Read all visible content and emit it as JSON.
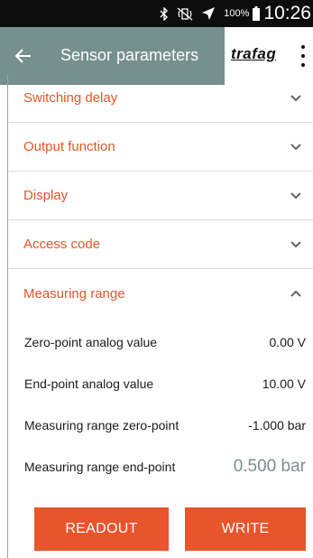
{
  "status_bar": {
    "battery_percent": "100%",
    "time": "10:26",
    "icons": [
      "bluetooth-icon",
      "vibrate-off-icon",
      "airplane-mode-icon",
      "battery-icon"
    ]
  },
  "app_bar": {
    "title": "Sensor parameters",
    "logo_text": "trafag",
    "colors": {
      "bar": "#76908e",
      "accent": "#e4552a"
    }
  },
  "sections": [
    {
      "label": "Switching delay",
      "state": "collapsed"
    },
    {
      "label": "Output function",
      "state": "collapsed"
    },
    {
      "label": "Display",
      "state": "collapsed"
    },
    {
      "label": "Access code",
      "state": "collapsed"
    },
    {
      "label": "Measuring range",
      "state": "expanded"
    }
  ],
  "params": [
    {
      "label": "Zero-point analog value",
      "value": "0.00 V"
    },
    {
      "label": "End-point analog value",
      "value": "10.00 V"
    },
    {
      "label": "Measuring range zero-point",
      "value": "-1.000 bar"
    },
    {
      "label": "Measuring range end-point",
      "value": "0.500 bar"
    }
  ],
  "buttons": {
    "readout": "READOUT",
    "write": "WRITE"
  }
}
